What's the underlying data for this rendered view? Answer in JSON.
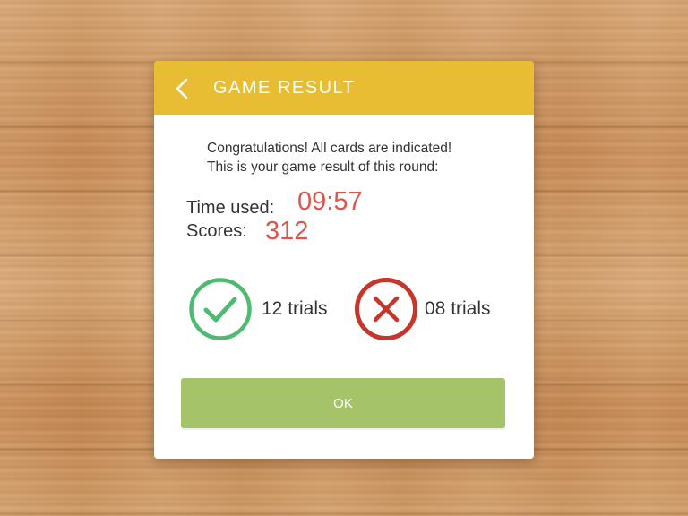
{
  "dialog": {
    "title": "GAME RESULT",
    "back_icon": "chevron-left-icon",
    "message_line1": "Congratulations! All cards are indicated!",
    "message_line2": "This is your game result of this round:",
    "time_label": "Time used:",
    "time_value": "09:57",
    "score_label": "Scores:",
    "score_value": "312",
    "correct": {
      "icon": "check-circle-icon",
      "label": "12 trials"
    },
    "wrong": {
      "icon": "x-circle-icon",
      "label": "08 trials"
    },
    "ok_label": "OK"
  },
  "colors": {
    "header": "#e8bd33",
    "value_red": "#d9584b",
    "check_green": "#4fba72",
    "cross_red": "#c7362b",
    "ok_button": "#a5c46a",
    "wood": "#cf9a66"
  }
}
